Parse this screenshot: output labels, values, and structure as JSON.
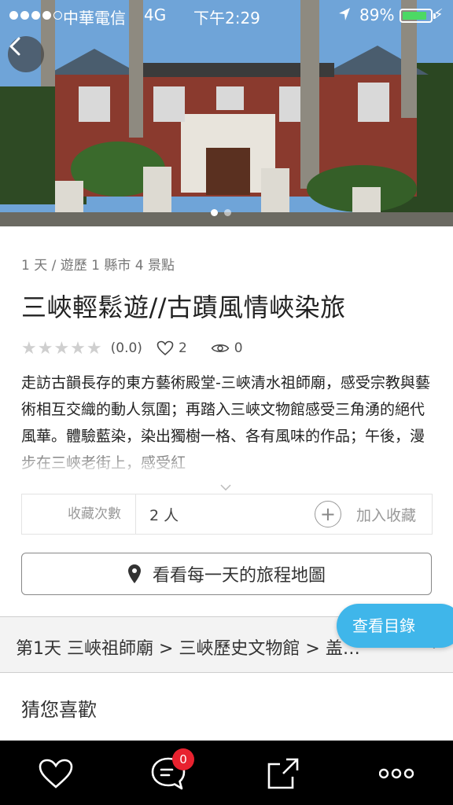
{
  "status_bar": {
    "carrier": "中華電信",
    "network": "4G",
    "time": "下午2:29",
    "battery": "89%",
    "battery_level": 0.89,
    "signal_bars": 4
  },
  "hero": {
    "image_count": 2,
    "active_index": 0
  },
  "trip": {
    "meta": "1 天 / 遊歷 1 縣市 4 景點",
    "title": "三峽輕鬆遊//古蹟風情峽染旅",
    "rating_text": "(0.0)",
    "rating_value": 0,
    "rating_max": 5,
    "likes": "2",
    "views": "0",
    "description": "走訪古韻長存的東方藝術殿堂-三峽清水祖師廟，感受宗教與藝術相互交織的動人氛圍；再踏入三峽文物館感受三角湧的絕代風華。體驗藍染，染出獨樹一格、各有風味的作品；午後，漫步在三峽老街上，感受紅"
  },
  "collect": {
    "label": "收藏次數",
    "count": "2 人",
    "add_label": "加入收藏"
  },
  "map_button": {
    "label": "看看每一天的旅程地圖"
  },
  "day": {
    "route": "第1天 三峽祖師廟 > 三峽歷史文物館 > 盖…"
  },
  "catalog_button": {
    "label": "查看目錄"
  },
  "recommend": {
    "title": "猜您喜歡"
  },
  "toolbar": {
    "comment_badge": "0"
  },
  "colors": {
    "accent": "#3fb6ea",
    "badge": "#e8222f",
    "battery": "#4cd964",
    "toolbar_bg": "#000000"
  }
}
